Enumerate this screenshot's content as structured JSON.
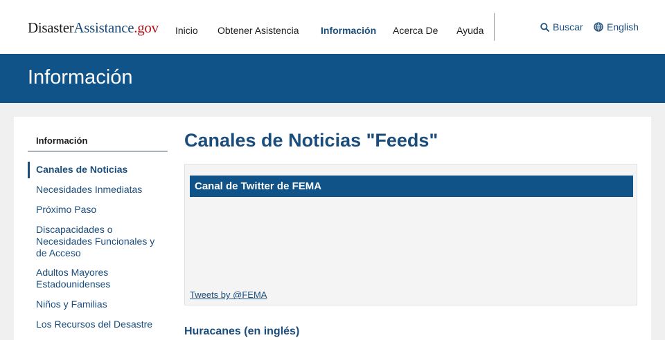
{
  "header": {
    "logo": {
      "part1": "Disaster",
      "part2": "Assistance",
      "part3": ".gov"
    },
    "nav": [
      {
        "label": "Inicio"
      },
      {
        "label": "Obtener Asistencia"
      },
      {
        "label": "Información",
        "active": true
      },
      {
        "label": "Acerca De"
      },
      {
        "label": "Ayuda"
      }
    ],
    "search_label": "Buscar",
    "language_label": "English"
  },
  "banner": {
    "title": "Información"
  },
  "sidebar": {
    "title": "Información",
    "items": [
      {
        "label": "Canales de Noticias",
        "current": true
      },
      {
        "label": "Necesidades Inmediatas"
      },
      {
        "label": "Próximo Paso"
      },
      {
        "label": "Discapacidades o Necesidades Funcionales y de Acceso"
      },
      {
        "label": "Adultos Mayores Estadounidenses"
      },
      {
        "label": "Niños y Familias"
      },
      {
        "label": "Los Recursos del Desastre"
      }
    ]
  },
  "main": {
    "title": "Canales de Noticias \"Feeds\"",
    "feed": {
      "header": "Canal de Twitter de FEMA",
      "link": "Tweets by @FEMA"
    },
    "subheading": "Huracanes (en inglés)"
  },
  "colors": {
    "brand_blue": "#0f5388",
    "link_blue": "#1a4d7c",
    "logo_dot": "#b5121b"
  }
}
